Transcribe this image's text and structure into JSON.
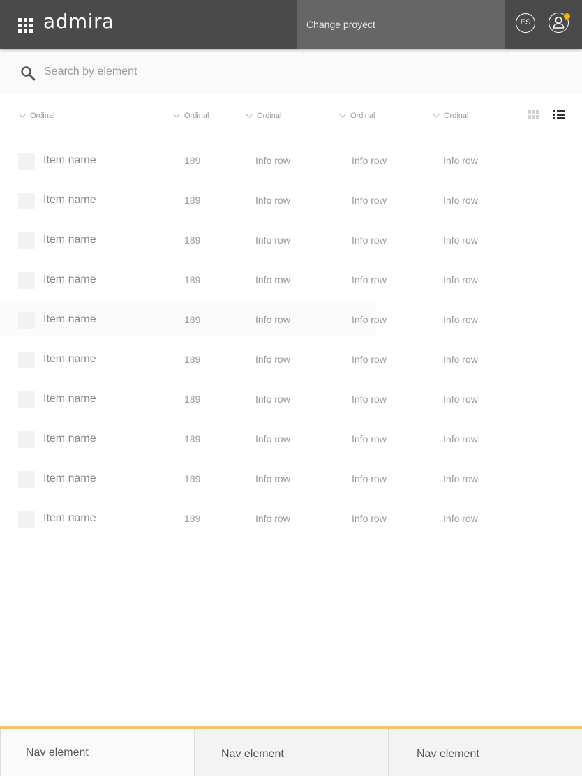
{
  "app": {
    "logo": "admira"
  },
  "header": {
    "project_label": "Change proyect",
    "language": "ES"
  },
  "search": {
    "placeholder": "Search by element"
  },
  "columns": [
    "Ordinal",
    "Ordinal",
    "Ordinal",
    "Ordinal",
    "Ordinal"
  ],
  "rows": [
    {
      "name": "Item name",
      "number": "189",
      "info1": "Info row",
      "info2": "Info row",
      "info3": "Info row"
    },
    {
      "name": "Item name",
      "number": "189",
      "info1": "Info row",
      "info2": "Info row",
      "info3": "Info row"
    },
    {
      "name": "Item name",
      "number": "189",
      "info1": "Info row",
      "info2": "Info row",
      "info3": "Info row"
    },
    {
      "name": "Item name",
      "number": "189",
      "info1": "Info row",
      "info2": "Info row",
      "info3": "Info row"
    },
    {
      "name": "Item name",
      "number": "189",
      "info1": "Info row",
      "info2": "Info row",
      "info3": "Info row"
    },
    {
      "name": "Item name",
      "number": "189",
      "info1": "Info row",
      "info2": "Info row",
      "info3": "Info row"
    },
    {
      "name": "Item name",
      "number": "189",
      "info1": "Info row",
      "info2": "Info row",
      "info3": "Info row"
    },
    {
      "name": "Item name",
      "number": "189",
      "info1": "Info row",
      "info2": "Info row",
      "info3": "Info row"
    },
    {
      "name": "Item name",
      "number": "189",
      "info1": "Info row",
      "info2": "Info row",
      "info3": "Info row"
    },
    {
      "name": "Item name",
      "number": "189",
      "info1": "Info row",
      "info2": "Info row",
      "info3": "Info row"
    }
  ],
  "bottom_nav": [
    "Nav element",
    "Nav element",
    "Nav element"
  ],
  "icons": {
    "apps": "apps-grid-icon",
    "user": "user-icon",
    "search": "search-icon",
    "sort": "chevron-down-icon",
    "grid_view": "grid-view-icon",
    "list_view": "list-view-icon"
  },
  "colors": {
    "topbar": "#4a4a4a",
    "project_switch": "#666666",
    "notification": "#f5b400",
    "nav_accent": "#f7c46c"
  }
}
